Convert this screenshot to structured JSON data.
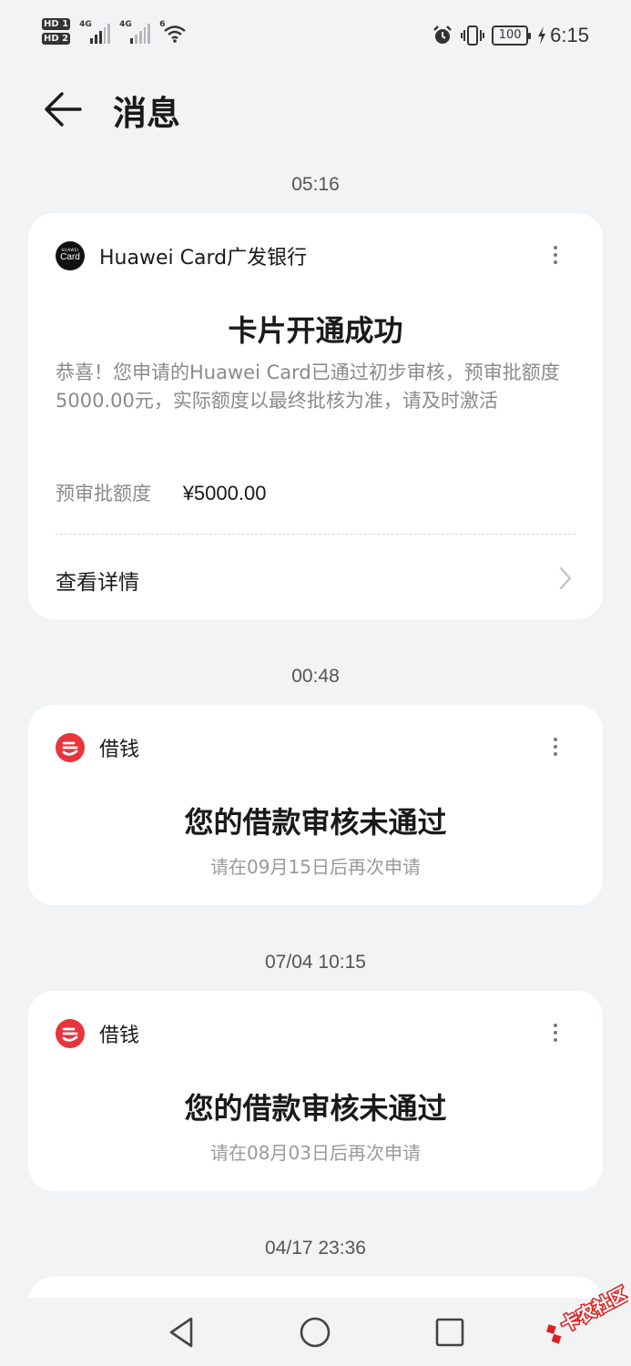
{
  "status_bar": {
    "hd1": "HD 1",
    "hd2": "HD 2",
    "net1": "4G",
    "net2": "4G",
    "wifi_badge": "6",
    "battery": "100",
    "time": "6:15",
    "icons": [
      "alarm-icon",
      "vibrate-icon",
      "battery-icon",
      "charging-icon",
      "wifi-icon",
      "signal-icon"
    ]
  },
  "header": {
    "title": "消息",
    "back_icon": "arrow-left-icon"
  },
  "messages": [
    {
      "time": "05:16",
      "app_name": "Huawei Card广发银行",
      "logo_line1": "HUAWEI",
      "logo_line2": "Card",
      "title": "卡片开通成功",
      "body": "恭喜！您申请的Huawei Card已通过初步审核，预审批额度5000.00元，实际额度以最终批核为准，请及时激活",
      "amount_label": "预审批额度",
      "amount_value": "¥5000.00",
      "action": "查看详情"
    },
    {
      "time": "00:48",
      "app_name": "借钱",
      "title": "您的借款审核未通过",
      "subtitle": "请在09月15日后再次申请"
    },
    {
      "time": "07/04 10:15",
      "app_name": "借钱",
      "title": "您的借款审核未通过",
      "subtitle": "请在08月03日后再次申请"
    },
    {
      "time": "04/17 23:36"
    }
  ],
  "watermark": "卡农社区",
  "colors": {
    "background": "#f1f3f5",
    "card": "#ffffff",
    "jieqian_brand": "#e8343c",
    "watermark_red": "#e02020"
  }
}
